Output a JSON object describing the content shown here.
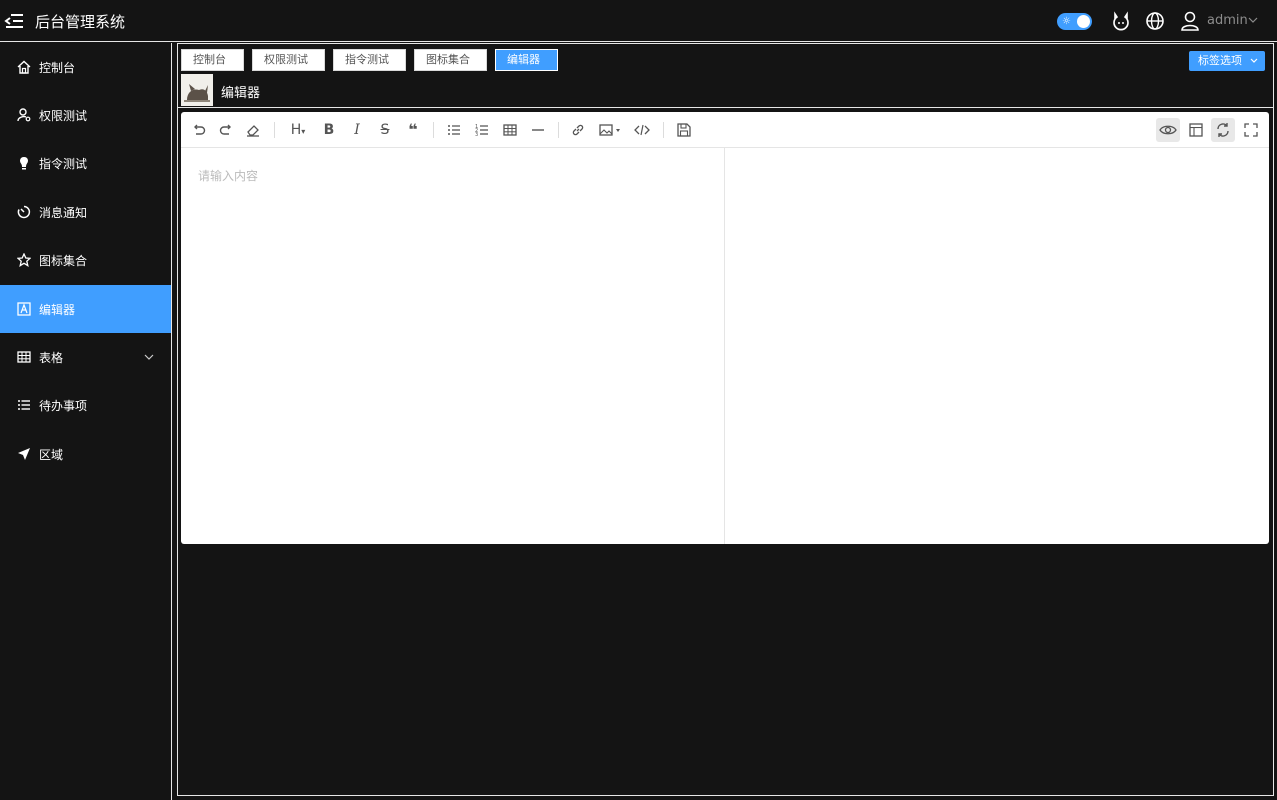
{
  "app": {
    "title": "后台管理系统"
  },
  "header": {
    "user": "admin"
  },
  "sidebar": {
    "items": [
      {
        "label": "控制台",
        "icon": "home-icon"
      },
      {
        "label": "权限测试",
        "icon": "user-key-icon"
      },
      {
        "label": "指令测试",
        "icon": "lightbulb-icon"
      },
      {
        "label": "消息通知",
        "icon": "timer-icon"
      },
      {
        "label": "图标集合",
        "icon": "star-icon"
      },
      {
        "label": "编辑器",
        "icon": "editor-icon",
        "active": true
      },
      {
        "label": "表格",
        "icon": "grid-icon",
        "expandable": true
      },
      {
        "label": "待办事项",
        "icon": "list-icon"
      },
      {
        "label": "区域",
        "icon": "send-icon"
      }
    ]
  },
  "tabs": [
    {
      "label": "控制台"
    },
    {
      "label": "权限测试"
    },
    {
      "label": "指令测试"
    },
    {
      "label": "图标集合"
    },
    {
      "label": "编辑器",
      "active": true
    }
  ],
  "tag_options": {
    "label": "标签选项"
  },
  "page": {
    "title": "编辑器"
  },
  "editor": {
    "placeholder": "请输入内容",
    "toolbar": [
      "undo-icon",
      "redo-icon",
      "eraser-icon",
      "heading-icon",
      "bold-icon",
      "italic-icon",
      "strikethrough-icon",
      "quote-icon",
      "unordered-list-icon",
      "ordered-list-icon",
      "table-icon",
      "horizontal-rule-icon",
      "link-icon",
      "image-icon",
      "code-icon",
      "save-icon",
      "preview-icon",
      "layout-icon",
      "sync-scroll-icon",
      "fullscreen-icon"
    ],
    "heading_glyph": "H",
    "bold_glyph": "B",
    "italic_glyph": "I",
    "strike_glyph": "S",
    "quote_glyph": "❝"
  },
  "colors": {
    "accent": "#409eff",
    "background": "#141414"
  }
}
